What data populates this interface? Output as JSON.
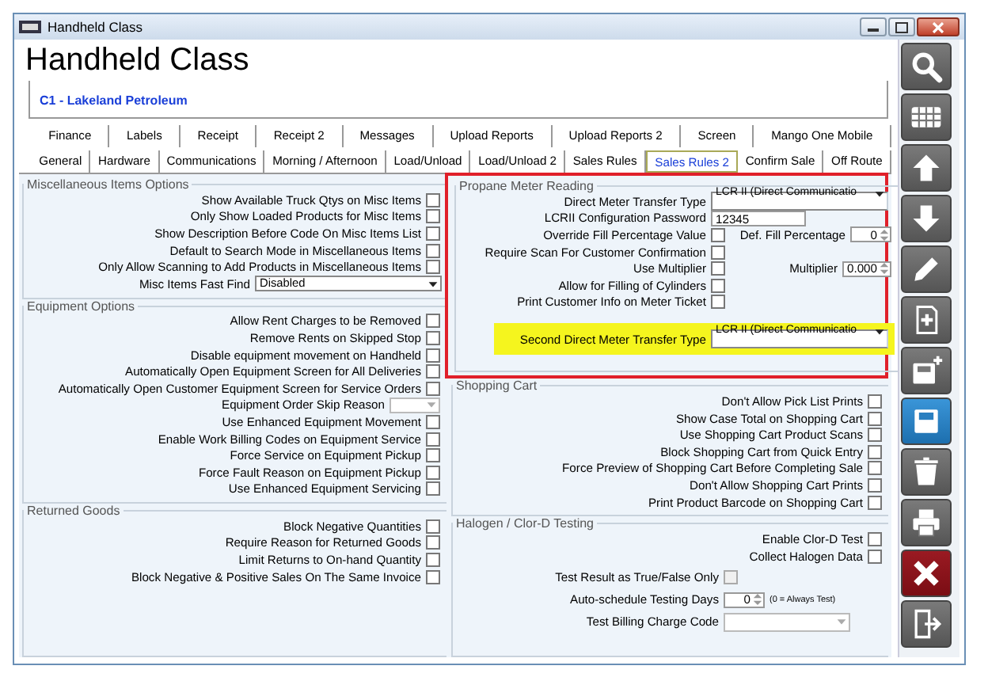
{
  "window": {
    "title": "Handheld Class"
  },
  "heading": "Handheld Class",
  "customer": "C1 - Lakeland Petroleum",
  "tab_rows": [
    [
      {
        "label": "Finance",
        "selected": false
      },
      {
        "label": "Labels",
        "selected": false
      },
      {
        "label": "Receipt",
        "selected": false
      },
      {
        "label": "Receipt 2",
        "selected": false
      },
      {
        "label": "Messages",
        "selected": false
      },
      {
        "label": "Upload Reports",
        "selected": false
      },
      {
        "label": "Upload Reports 2",
        "selected": false
      },
      {
        "label": "Screen",
        "selected": false
      },
      {
        "label": "Mango One Mobile",
        "selected": false
      }
    ],
    [
      {
        "label": "General",
        "selected": false
      },
      {
        "label": "Hardware",
        "selected": false
      },
      {
        "label": "Communications",
        "selected": false
      },
      {
        "label": "Morning / Afternoon",
        "selected": false
      },
      {
        "label": "Load/Unload",
        "selected": false
      },
      {
        "label": "Load/Unload 2",
        "selected": false
      },
      {
        "label": "Sales Rules",
        "selected": false
      },
      {
        "label": "Sales Rules 2",
        "selected": true
      },
      {
        "label": "Confirm Sale",
        "selected": false
      },
      {
        "label": "Off Route",
        "selected": false
      }
    ]
  ],
  "left_groups": [
    {
      "title": "Miscellaneous Items Options",
      "options": [
        {
          "kind": "checkbox",
          "label": "Show Available Truck Qtys on Misc Items",
          "checked": false
        },
        {
          "kind": "checkbox",
          "label": "Only Show Loaded Products for Misc Items",
          "checked": false
        },
        {
          "kind": "checkbox",
          "label": "Show Description Before Code On Misc Items List",
          "checked": false
        },
        {
          "kind": "checkbox",
          "label": "Default to Search Mode in Miscellaneous Items",
          "checked": false
        },
        {
          "kind": "checkbox",
          "label": "Only Allow Scanning to Add Products in Miscellaneous Items",
          "checked": false
        },
        {
          "kind": "dropdown",
          "label": "Misc Items Fast Find",
          "value": "Disabled",
          "disabled": false
        }
      ]
    },
    {
      "title": "Equipment Options",
      "options": [
        {
          "kind": "checkbox",
          "label": "Allow Rent Charges to be Removed",
          "checked": false
        },
        {
          "kind": "checkbox",
          "label": "Remove Rents on Skipped Stop",
          "checked": false
        },
        {
          "kind": "checkbox",
          "label": "Disable equipment movement on Handheld",
          "checked": false
        },
        {
          "kind": "checkbox",
          "label": "Automatically Open Equipment Screen for All Deliveries",
          "checked": false
        },
        {
          "kind": "checkbox",
          "label": "Automatically Open Customer Equipment Screen for Service Orders",
          "checked": false
        },
        {
          "kind": "dropdown",
          "label": "Equipment Order Skip Reason",
          "disabled": true
        },
        {
          "kind": "checkbox",
          "label": "Use Enhanced Equipment Movement",
          "checked": false
        },
        {
          "kind": "checkbox",
          "label": "Enable Work Billing Codes on Equipment Service",
          "checked": false
        },
        {
          "kind": "checkbox",
          "label": "Force Service on Equipment Pickup",
          "checked": false
        },
        {
          "kind": "checkbox",
          "label": "Force Fault Reason on Equipment Pickup",
          "checked": false
        },
        {
          "kind": "checkbox",
          "label": "Use Enhanced Equipment Servicing",
          "checked": false
        }
      ]
    },
    {
      "title": "Returned Goods",
      "options": [
        {
          "kind": "checkbox",
          "label": "Block Negative Quantities",
          "checked": false
        },
        {
          "kind": "checkbox",
          "label": "Require Reason for Returned Goods",
          "checked": false
        },
        {
          "kind": "checkbox",
          "label": "Limit Returns to On-hand Quantity",
          "checked": false
        },
        {
          "kind": "checkbox",
          "label": "Block Negative & Positive Sales On The Same Invoice",
          "checked": false
        }
      ]
    }
  ],
  "propane": {
    "title": "Propane Meter Reading",
    "outlined": true,
    "options": [
      {
        "kind": "dropdown",
        "label": "Direct Meter Transfer Type",
        "value": "LCR II (Direct Communicatio"
      },
      {
        "kind": "text",
        "label": "LCRII Configuration Password",
        "value": "12345"
      },
      {
        "kind": "checkbox",
        "label": "Override Fill Percentage Value",
        "checked": false,
        "extra": {
          "label": "Def. Fill Percentage",
          "value": "0"
        }
      },
      {
        "kind": "checkbox",
        "label": "Require Scan For Customer Confirmation",
        "checked": false
      },
      {
        "kind": "checkbox",
        "label": "Use Multiplier",
        "checked": false,
        "extra": {
          "label": "Multiplier",
          "value": "0.000"
        }
      },
      {
        "kind": "checkbox",
        "label": "Allow for Filling of Cylinders",
        "checked": false
      },
      {
        "kind": "checkbox",
        "label": "Print Customer Info on Meter Ticket",
        "checked": false
      },
      {
        "kind": "dropdown",
        "label": "Second Direct Meter Transfer Type",
        "value": "LCR II (Direct Communicatio",
        "highlighted": true
      }
    ]
  },
  "shopping_cart": {
    "title": "Shopping Cart",
    "options": [
      {
        "label": "Don't Allow Pick List Prints",
        "checked": false
      },
      {
        "label": "Show Case Total on Shopping Cart",
        "checked": false
      },
      {
        "label": "Use Shopping Cart Product Scans",
        "checked": false
      },
      {
        "label": "Block Shopping Cart from Quick Entry",
        "checked": false
      },
      {
        "label": "Force Preview of Shopping Cart Before Completing Sale",
        "checked": false
      },
      {
        "label": "Don't Allow Shopping Cart Prints",
        "checked": false
      },
      {
        "label": "Print Product Barcode on Shopping Cart",
        "checked": false
      }
    ]
  },
  "halogen": {
    "title": "Halogen / Clor-D Testing",
    "checks": [
      {
        "label": "Enable Clor-D Test",
        "checked": false
      },
      {
        "label": "Collect Halogen Data",
        "checked": false
      }
    ],
    "settings": [
      {
        "kind": "checkbox",
        "label": "Test Result as True/False Only",
        "checked": false,
        "disabled": true
      },
      {
        "kind": "spinner",
        "label": "Auto-schedule Testing Days",
        "value": "0",
        "note": "(0 = Always Test)"
      },
      {
        "kind": "dropdown",
        "label": "Test Billing Charge Code",
        "disabled": true
      }
    ]
  },
  "toolbar": [
    {
      "kind": "search"
    },
    {
      "kind": "grid"
    },
    {
      "kind": "up"
    },
    {
      "kind": "down"
    },
    {
      "kind": "edit"
    },
    {
      "kind": "add-page"
    },
    {
      "kind": "add-disk"
    },
    {
      "kind": "save"
    },
    {
      "kind": "delete"
    },
    {
      "kind": "print"
    },
    {
      "kind": "cancel"
    },
    {
      "kind": "exit"
    }
  ]
}
